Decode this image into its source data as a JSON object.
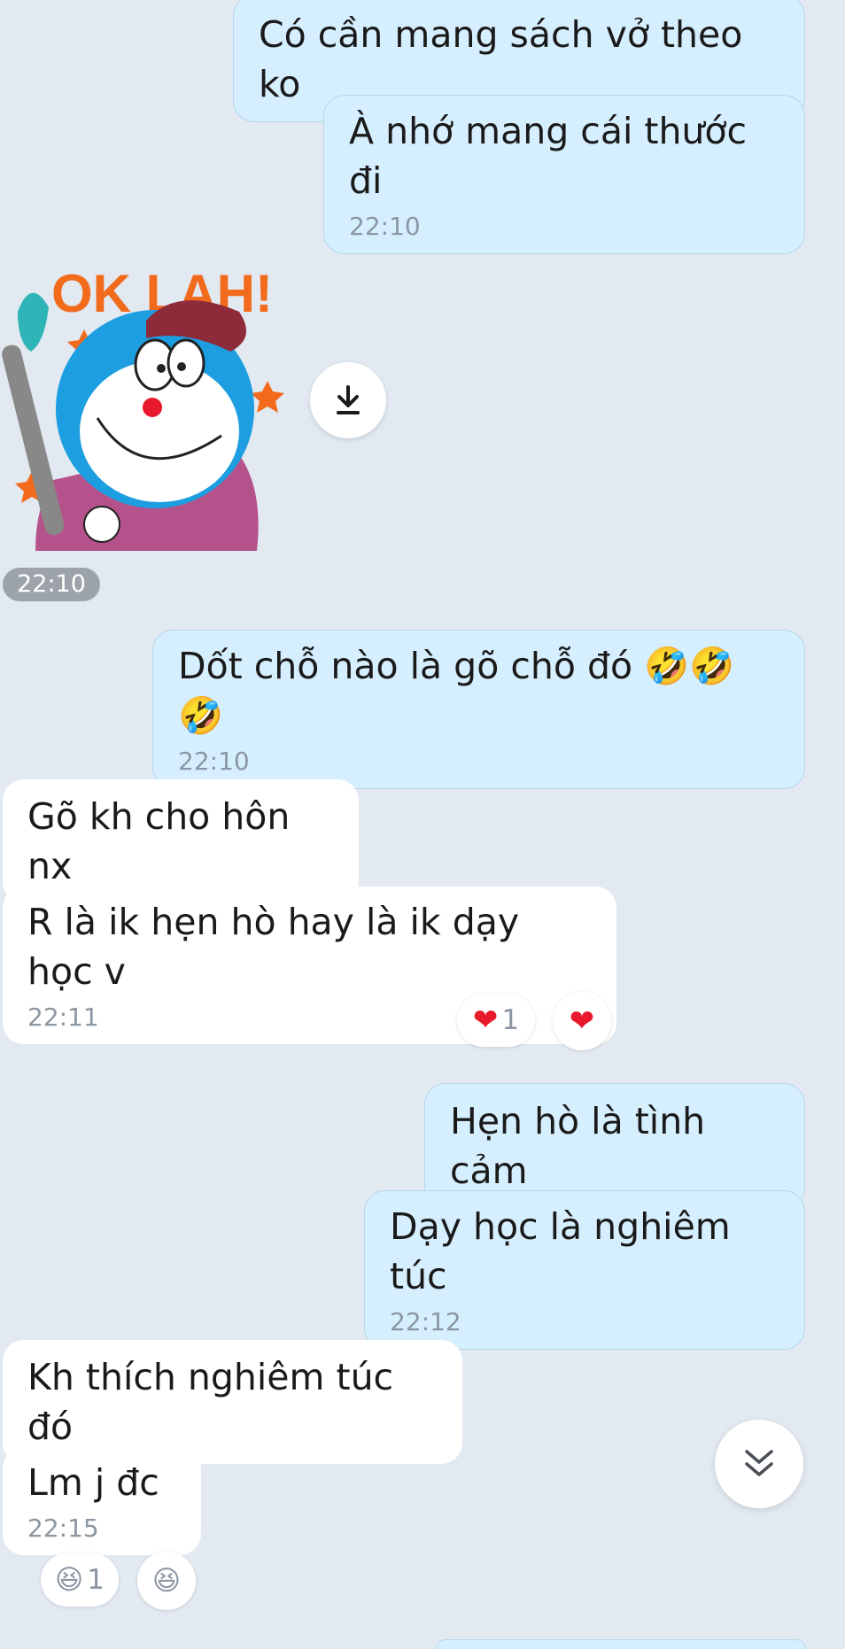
{
  "messages": [
    {
      "text": "Có cần mang sách vở theo ko"
    },
    {
      "text": "À nhớ mang cái thước đi",
      "time": "22:10"
    },
    {
      "text": "Dốt chỗ nào là gõ chỗ đó 🤣🤣🤣",
      "time": "22:10"
    },
    {
      "text": "Gõ kh cho hôn nx"
    },
    {
      "text": "R là ik hẹn hò hay là ik dạy học v",
      "time": "22:11"
    },
    {
      "text": "Hẹn hò là tình cảm"
    },
    {
      "text": "Dạy học là nghiêm túc",
      "time": "22:12"
    },
    {
      "text": "Kh thích nghiêm túc đó"
    },
    {
      "text": "Lm j đc",
      "time": "22:15"
    }
  ],
  "sticker": {
    "caption": "OK LAH!",
    "time": "22:10",
    "icon": "doraemon-sticker"
  },
  "reactions": {
    "msg5": {
      "emoji": "❤",
      "count": "1",
      "quick": "❤"
    },
    "msg9": {
      "emoji": "😆",
      "count": "1",
      "quick": "😆"
    }
  },
  "icons": {
    "download": "download-icon",
    "scroll": "double-chevron-down-icon"
  }
}
